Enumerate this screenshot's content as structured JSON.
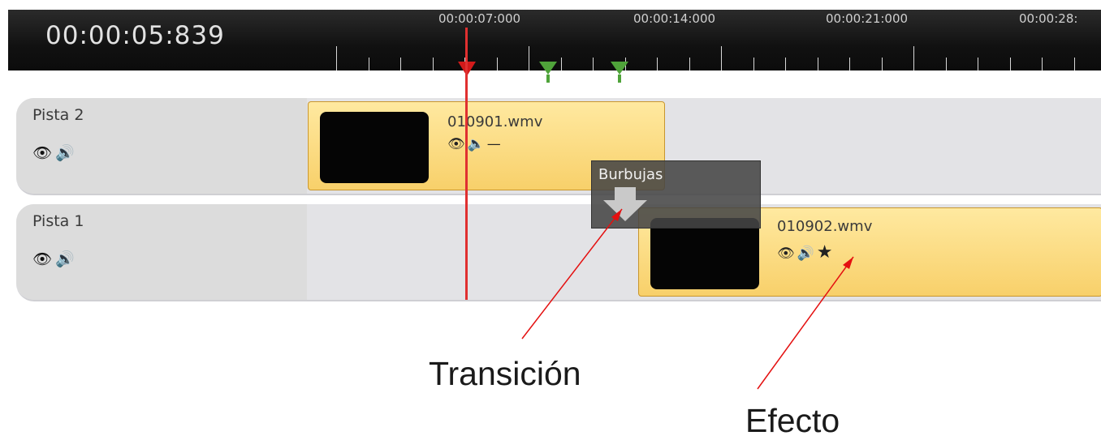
{
  "ruler": {
    "timecode": "00:00:05:839",
    "labels": [
      "00:00:07:000",
      "00:00:14:000",
      "00:00:21:000",
      "00:00:28:"
    ]
  },
  "tracks": [
    {
      "name": "Pista 2",
      "icons": [
        "eye-icon",
        "speaker-icon"
      ]
    },
    {
      "name": "Pista 1",
      "icons": [
        "eye-icon",
        "speaker-icon"
      ]
    }
  ],
  "clips": [
    {
      "name": "010901.wmv",
      "icons": [
        "eye-icon",
        "muted-speaker-icon"
      ]
    },
    {
      "name": "010902.wmv",
      "icons": [
        "eye-icon",
        "speaker-icon",
        "star-icon"
      ]
    }
  ],
  "transition": {
    "label": "Burbujas"
  },
  "annotations": {
    "transition": "Transición",
    "effect": "Efecto"
  },
  "colors": {
    "playhead": "#e03030",
    "clip_fill": "#f8d06a",
    "marker_green": "#4fa33a",
    "annotation_line": "#e41010"
  }
}
